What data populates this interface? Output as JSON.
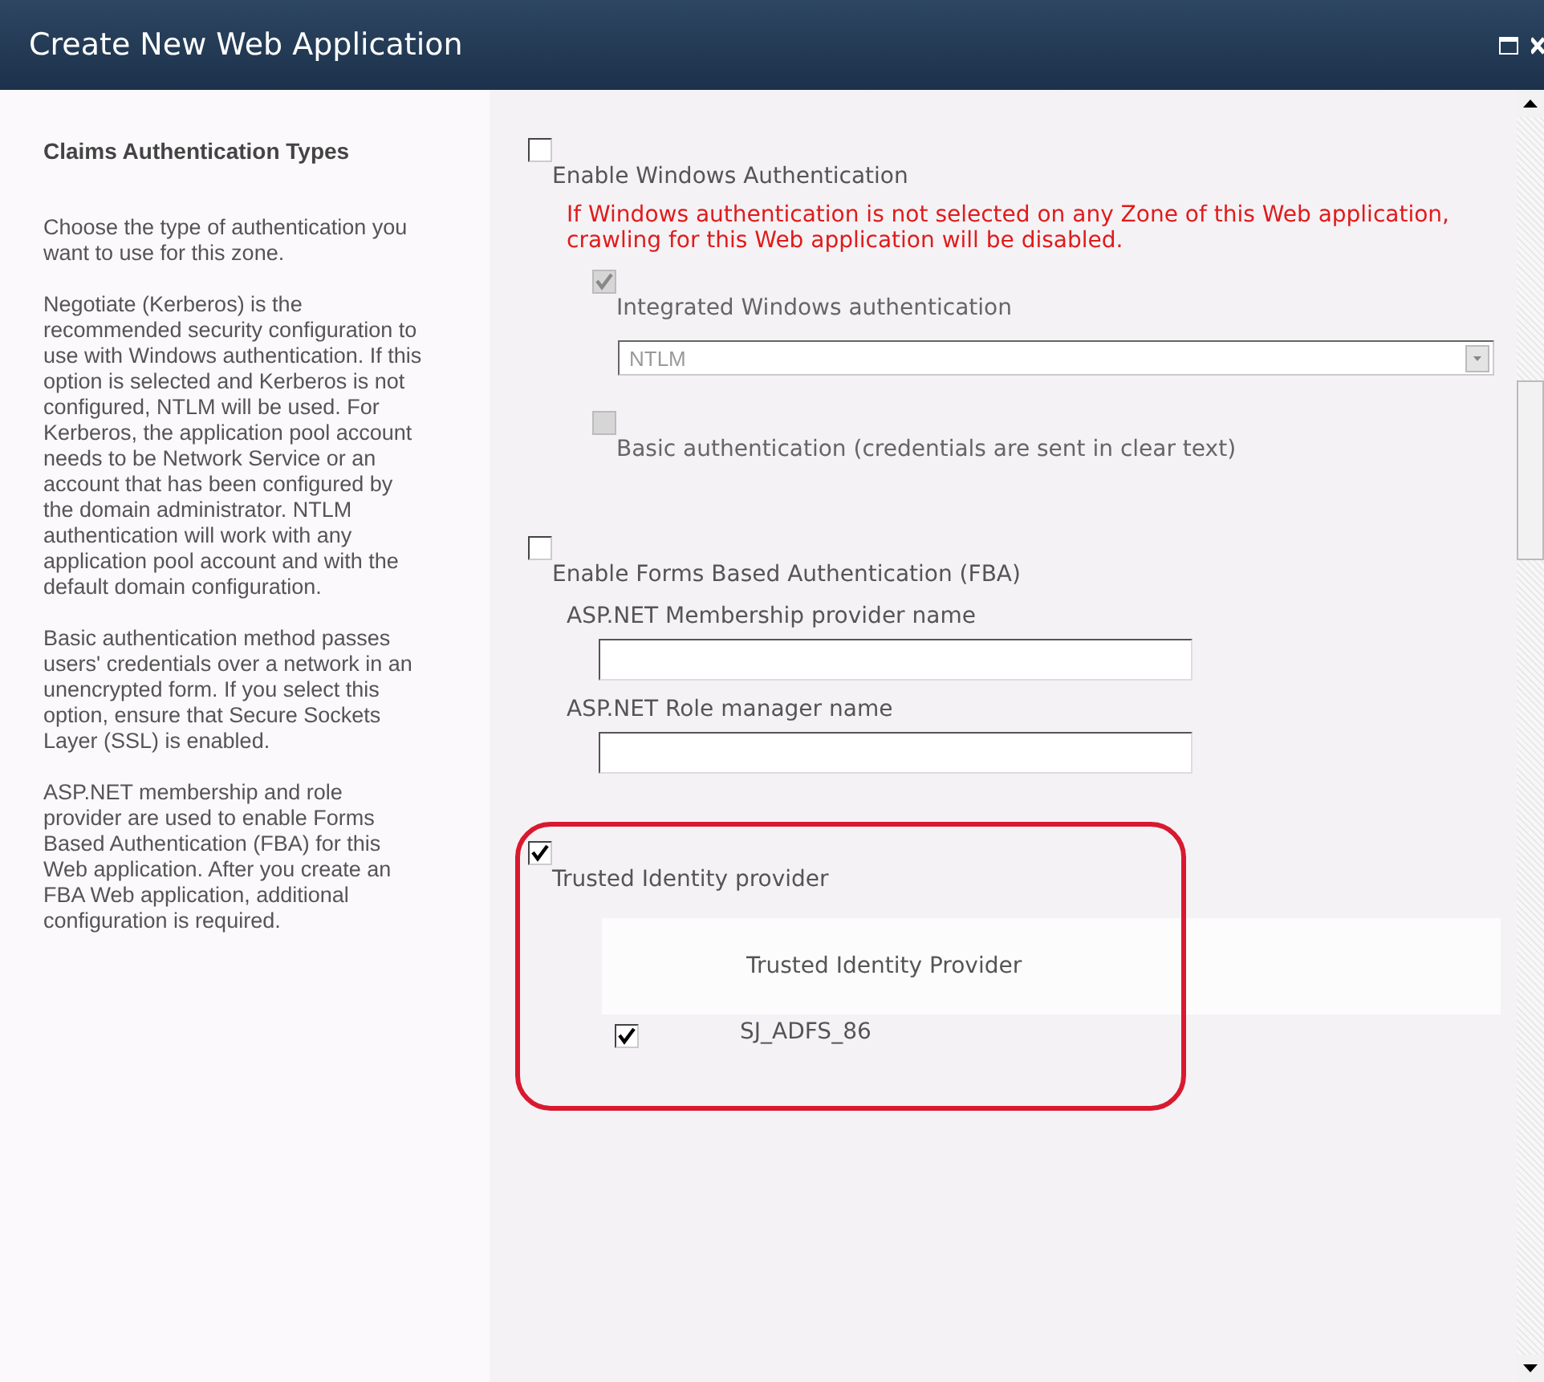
{
  "window": {
    "title": "Create New Web Application"
  },
  "description": {
    "heading": "Claims Authentication Types",
    "paragraphs": [
      "Choose the type of authentication you want to use for this zone.",
      "Negotiate (Kerberos) is the recommended security configuration to use with Windows authentication. If this option is selected and Kerberos is not configured, NTLM will be used. For Kerberos, the application pool account needs to be Network Service or an account that has been configured by the domain administrator. NTLM authentication will work with any application pool account and with the default domain configuration.",
      "Basic authentication method passes users' credentials over a network in an unencrypted form. If you select this option, ensure that Secure Sockets Layer (SSL) is enabled.",
      "ASP.NET membership and role provider are used to enable Forms Based Authentication (FBA) for this Web application. After you create an FBA Web application, additional configuration is required."
    ]
  },
  "windows_auth": {
    "label": "Enable Windows Authentication",
    "checked": false,
    "warning": "If Windows authentication is not selected on any Zone of this Web application, crawling for this Web application will be disabled.",
    "integrated": {
      "label": "Integrated Windows authentication",
      "checked": true,
      "disabled": true
    },
    "dropdown": {
      "value": "NTLM",
      "disabled": true
    },
    "basic": {
      "label": "Basic authentication (credentials are sent in clear text)",
      "checked": false,
      "disabled": true
    }
  },
  "fba": {
    "label": "Enable Forms Based Authentication (FBA)",
    "checked": false,
    "fields": [
      {
        "label": "ASP.NET Membership provider name"
      },
      {
        "label": "ASP.NET Role manager name"
      }
    ]
  },
  "trusted": {
    "label": "Trusted Identity provider",
    "checked": true,
    "column": "Trusted Identity Provider",
    "rows": [
      {
        "name": "SJ_ADFS_86",
        "checked": true
      }
    ]
  }
}
